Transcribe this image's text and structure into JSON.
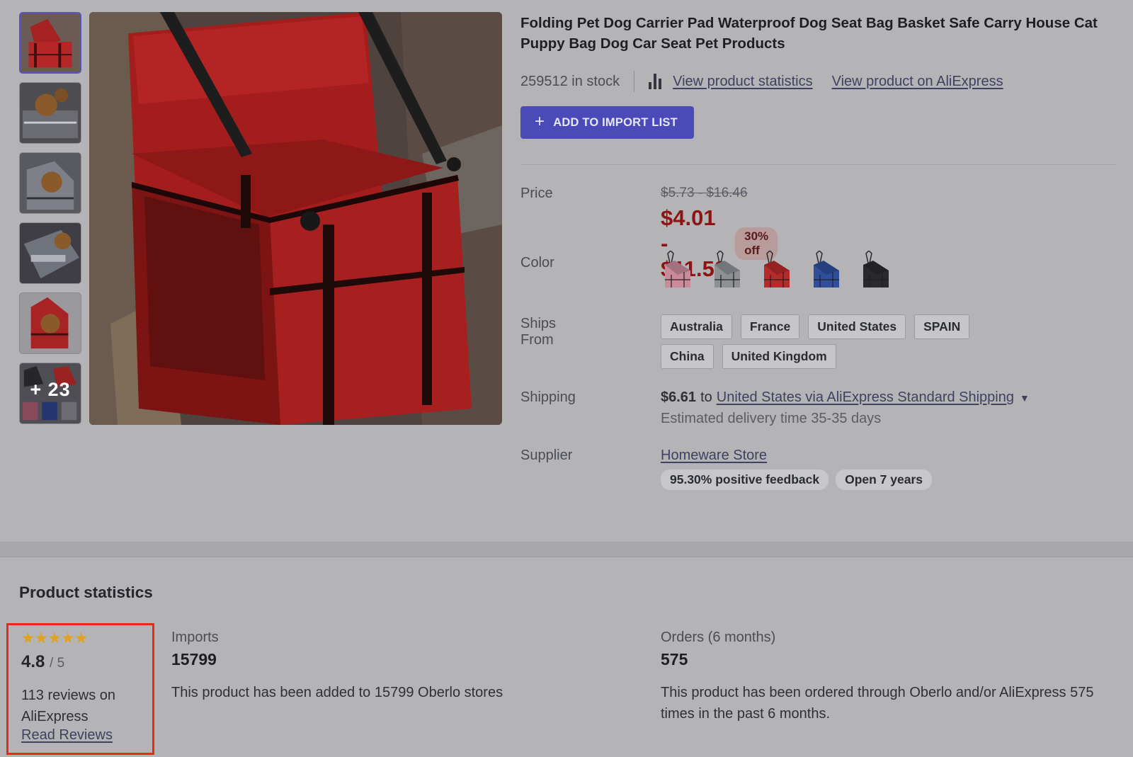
{
  "gallery": {
    "thumbnails": [
      {
        "alt": "red carrier"
      },
      {
        "alt": "dog in carrier"
      },
      {
        "alt": "grey carrier with dog"
      },
      {
        "alt": "carrier in car"
      },
      {
        "alt": "red carrier with teddy"
      },
      {
        "alt": "more images",
        "more_label": "+ 23"
      }
    ]
  },
  "product": {
    "title": "Folding Pet Dog Carrier Pad Waterproof Dog Seat Bag Basket Safe Carry House Cat Puppy Bag Dog Car Seat Pet Products",
    "stock": "259512 in stock",
    "view_stats_label": "View product statistics",
    "view_aliexpress_label": "View product on AliExpress",
    "import_button": {
      "icon": "plus-icon",
      "label": "ADD TO IMPORT LIST"
    }
  },
  "price": {
    "label": "Price",
    "original": "$5.73 - $16.46",
    "current": "$4.01 - $11.52",
    "discount": "30% off"
  },
  "color": {
    "label": "Color",
    "options": [
      {
        "name": "pink",
        "hex": "#c98a9a"
      },
      {
        "name": "grey",
        "hex": "#8d9095"
      },
      {
        "name": "red",
        "hex": "#b52a2a"
      },
      {
        "name": "blue",
        "hex": "#2f4f9a"
      },
      {
        "name": "black",
        "hex": "#2a2a2e"
      }
    ]
  },
  "ships_from": {
    "label": "Ships From",
    "countries": [
      "Australia",
      "France",
      "United States",
      "SPAIN",
      "China",
      "United Kingdom"
    ]
  },
  "shipping": {
    "label": "Shipping",
    "price": "$6.61",
    "to": "to",
    "method": "United States via AliExpress Standard Shipping",
    "estimate": "Estimated delivery time 35-35 days"
  },
  "supplier": {
    "label": "Supplier",
    "name": "Homeware Store",
    "feedback": "95.30% positive feedback",
    "open": "Open 7 years"
  },
  "statistics": {
    "title": "Product statistics",
    "rating": {
      "stars": "★★★★★",
      "value": "4.8",
      "of": "/ 5",
      "reviews": "113 reviews on AliExpress",
      "read_reviews": "Read Reviews"
    },
    "imports": {
      "label": "Imports",
      "value": "15799",
      "description": "This product has been added to 15799 Oberlo stores"
    },
    "orders": {
      "label": "Orders (6 months)",
      "value": "575",
      "description": "This product has been ordered through Oberlo and/or AliExpress 575 times in the past 6 months."
    }
  },
  "colors": {
    "accent": "#4a4bb8",
    "price_red": "#8d1414",
    "highlight_border": "#e32b17",
    "star": "#e0a21a"
  }
}
